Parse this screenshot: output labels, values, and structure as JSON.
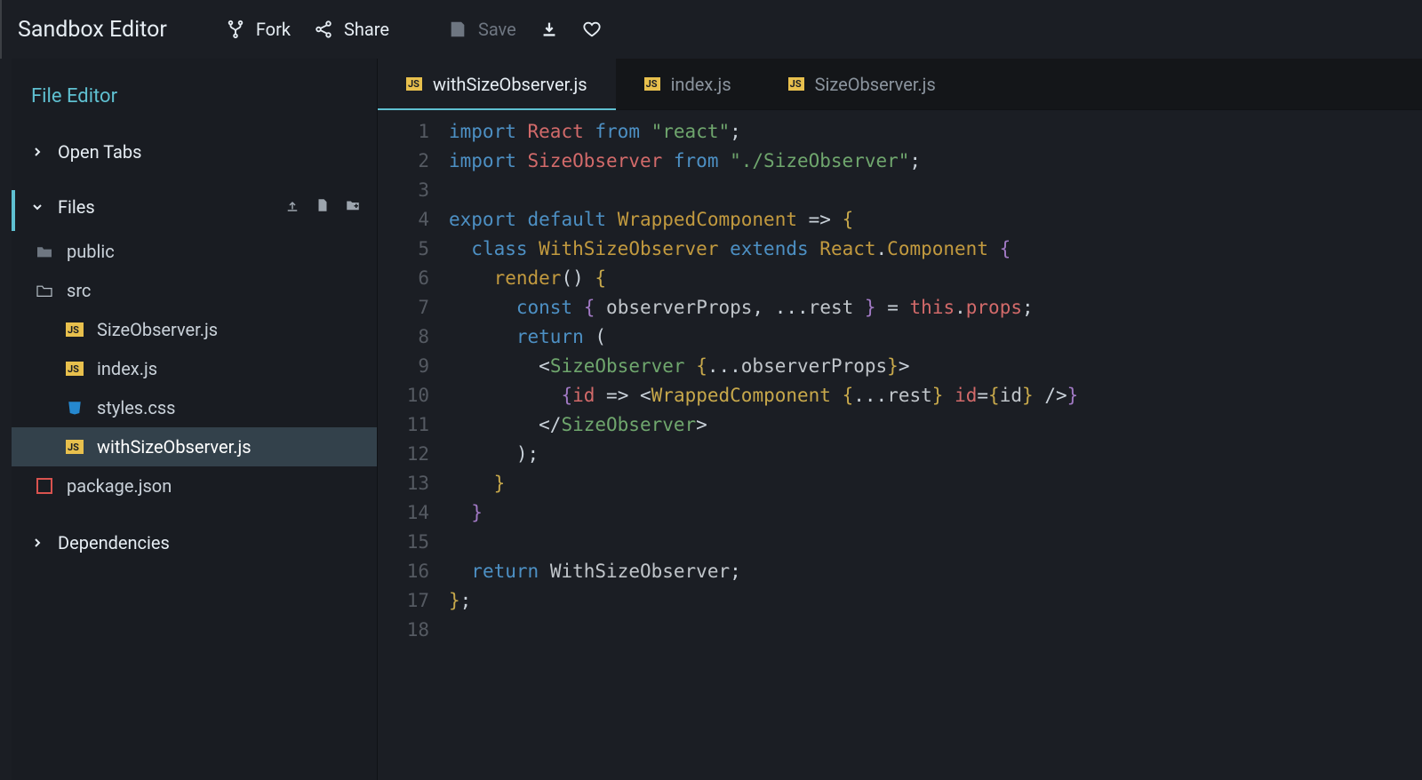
{
  "topbar": {
    "title": "Sandbox Editor",
    "fork": "Fork",
    "share": "Share",
    "save": "Save"
  },
  "sidebar": {
    "title": "File Editor",
    "open_tabs": "Open Tabs",
    "files_label": "Files",
    "dependencies": "Dependencies",
    "tree": {
      "public": "public",
      "src": "src",
      "size_observer": "SizeObserver.js",
      "index_js": "index.js",
      "styles_css": "styles.css",
      "with_size": "withSizeObserver.js",
      "package_json": "package.json"
    }
  },
  "tabs": [
    {
      "label": "withSizeObserver.js",
      "active": true
    },
    {
      "label": "index.js",
      "active": false
    },
    {
      "label": "SizeObserver.js",
      "active": false
    }
  ],
  "code": {
    "lines": [
      {
        "n": "1",
        "html": "<span class='k-import'>import</span> <span class='k-id-red'>React</span> <span class='k-from'>from</span> <span class='k-str'>\"react\"</span><span class='k-punc'>;</span>"
      },
      {
        "n": "2",
        "html": "<span class='k-import'>import</span> <span class='k-id-red'>SizeObserver</span> <span class='k-from'>from</span> <span class='k-str'>\"./SizeObserver\"</span><span class='k-punc'>;</span>"
      },
      {
        "n": "3",
        "html": ""
      },
      {
        "n": "4",
        "html": "<span class='k-export'>export</span> <span class='k-default'>default</span> <span class='k-fn'>WrappedComponent</span> <span class='k-punc'>=&gt;</span> <span class='k-brace-y'>{</span>"
      },
      {
        "n": "5",
        "html": "  <span class='k-class'>class</span> <span class='k-fn'>WithSizeObserver</span> <span class='k-extends'>extends</span> <span class='k-fn'>React</span><span class='k-punc'>.</span><span class='k-fn'>Component</span> <span class='k-brace-p'>{</span>"
      },
      {
        "n": "6",
        "html": "    <span class='k-fn'>render</span><span class='k-punc'>()</span> <span class='k-brace-y'>{</span>"
      },
      {
        "n": "7",
        "html": "      <span class='k-const'>const</span> <span class='k-brace-p'>{</span> <span class='k-prop'>observerProps</span><span class='k-punc'>,</span> <span class='k-punc'>...</span><span class='k-prop'>rest</span> <span class='k-brace-p'>}</span> <span class='k-punc'>=</span> <span class='k-this'>this</span><span class='k-punc'>.</span><span class='k-id-red'>props</span><span class='k-punc'>;</span>"
      },
      {
        "n": "8",
        "html": "      <span class='k-return'>return</span> <span class='k-punc'>(</span>"
      },
      {
        "n": "9",
        "html": "        <span class='k-punc'>&lt;</span><span class='k-jsx'>SizeObserver</span> <span class='k-brace-y'>{</span><span class='k-punc'>...</span><span class='k-prop'>observerProps</span><span class='k-brace-y'>}</span><span class='k-punc'>&gt;</span>"
      },
      {
        "n": "10",
        "html": "          <span class='k-brace-p'>{</span><span class='k-id-red'>id</span> <span class='k-punc'>=&gt;</span> <span class='k-punc'>&lt;</span><span class='k-comp'>WrappedComponent</span> <span class='k-brace-y'>{</span><span class='k-punc'>...</span><span class='k-prop'>rest</span><span class='k-brace-y'>}</span> <span class='k-id-red'>id</span><span class='k-punc'>=</span><span class='k-brace-y'>{</span><span class='k-prop'>id</span><span class='k-brace-y'>}</span> <span class='k-punc'>/&gt;</span><span class='k-brace-p'>}</span>"
      },
      {
        "n": "11",
        "html": "        <span class='k-punc'>&lt;/</span><span class='k-jsx'>SizeObserver</span><span class='k-punc'>&gt;</span>"
      },
      {
        "n": "12",
        "html": "      <span class='k-punc'>);</span>"
      },
      {
        "n": "13",
        "html": "    <span class='k-brace-y'>}</span>"
      },
      {
        "n": "14",
        "html": "  <span class='k-brace-p'>}</span>"
      },
      {
        "n": "15",
        "html": ""
      },
      {
        "n": "16",
        "html": "  <span class='k-return'>return</span> <span class='k-prop'>WithSizeObserver</span><span class='k-punc'>;</span>"
      },
      {
        "n": "17",
        "html": "<span class='k-brace-y'>}</span><span class='k-punc'>;</span>"
      },
      {
        "n": "18",
        "html": ""
      }
    ]
  }
}
